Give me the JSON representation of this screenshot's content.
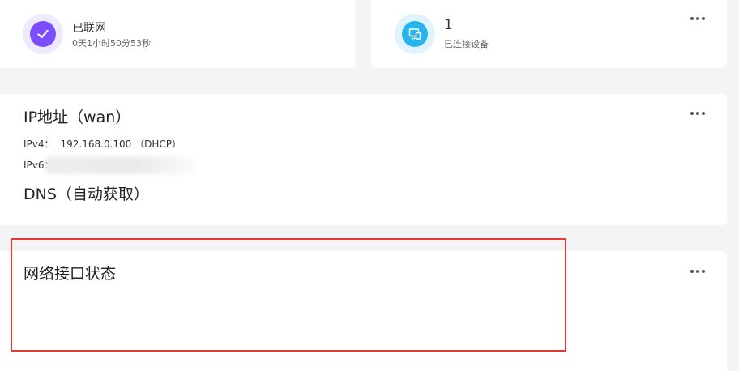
{
  "status_card": {
    "title": "已联网",
    "uptime": "0天1小时50分53秒",
    "icon": "check-icon"
  },
  "devices_card": {
    "count": "1",
    "label": "已连接设备",
    "icon": "devices-icon"
  },
  "ip_card": {
    "title": "IP地址（wan）",
    "ipv4_label": "IPv4：",
    "ipv4_value": "192.168.0.100 （DHCP）",
    "ipv6_label": "IPv6：",
    "dns_title": "DNS（自动获取）"
  },
  "iface_card": {
    "title": "网络接口状态"
  },
  "colors": {
    "status_accent": "#7c4dff",
    "devices_accent": "#2ab4ee",
    "highlight": "#e53935"
  }
}
